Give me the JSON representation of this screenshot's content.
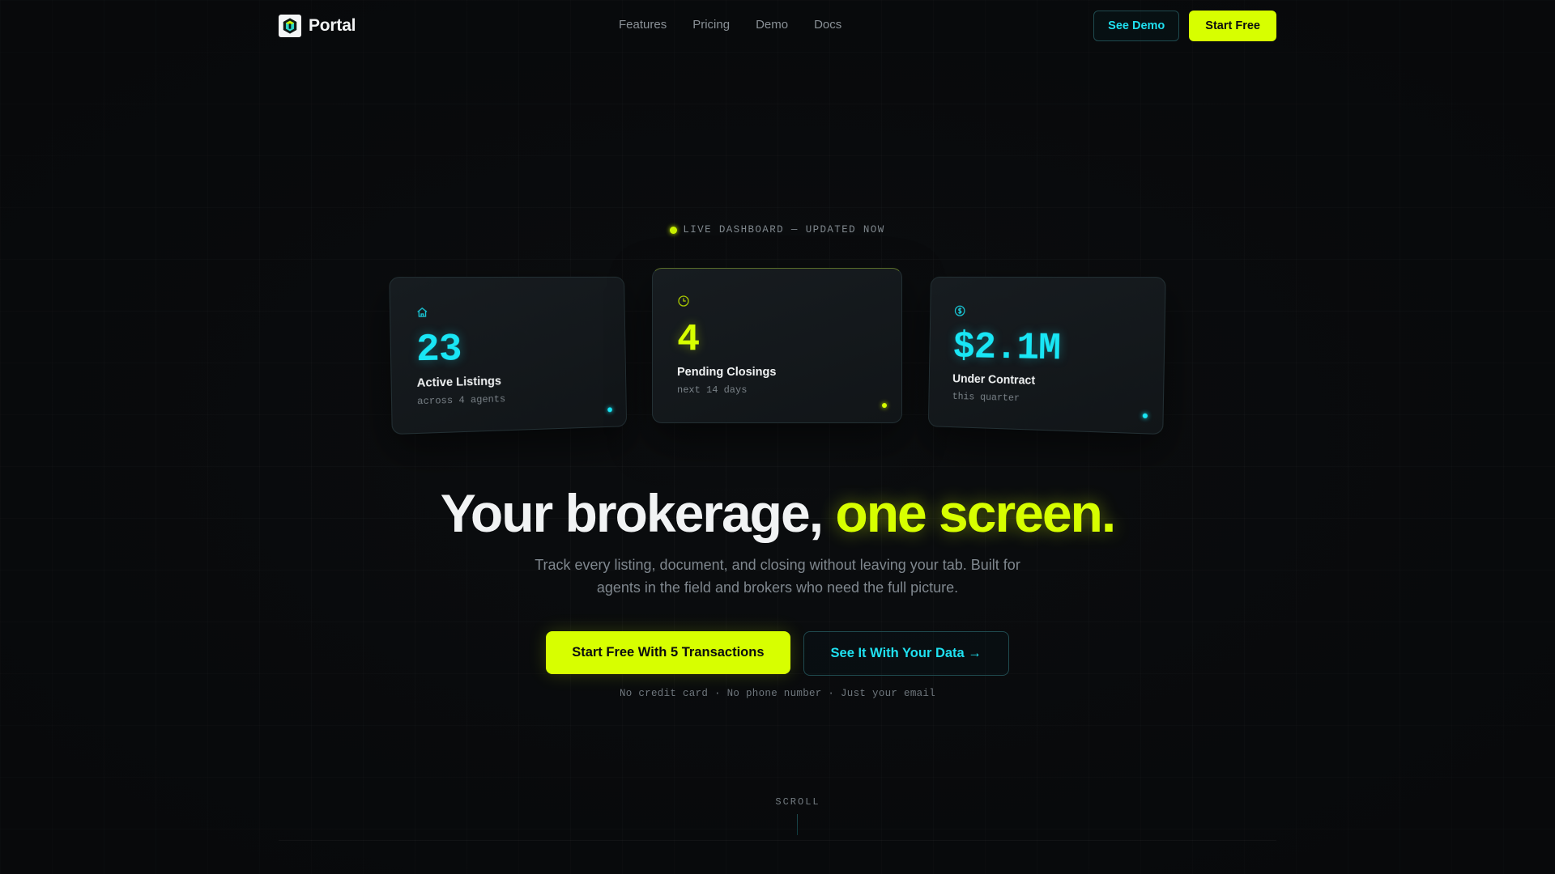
{
  "nav": {
    "brand": "Portal",
    "links": [
      "Features",
      "Pricing",
      "Demo",
      "Docs"
    ],
    "see_demo": "See Demo",
    "start_free": "Start Free"
  },
  "live": {
    "label": "LIVE DASHBOARD — UPDATED NOW"
  },
  "cards": [
    {
      "icon": "home-icon",
      "value": "23",
      "label": "Active Listings",
      "sub": "across 4 agents",
      "color": "#19e6f5"
    },
    {
      "icon": "clock-icon",
      "value": "4",
      "label": "Pending Closings",
      "sub": "next 14 days",
      "color": "#d7ff00"
    },
    {
      "icon": "dollar-icon",
      "value": "$2.1M",
      "label": "Under Contract",
      "sub": "this quarter",
      "color": "#19e6f5"
    }
  ],
  "hero": {
    "headline_main": "Your brokerage, ",
    "headline_accent": "one screen.",
    "subcopy": "Track every listing, document, and closing without leaving your tab. Built for agents in the field and brokers who need the full picture.",
    "cta_primary": "Start Free With 5 Transactions",
    "cta_secondary": "See It With Your Data →",
    "fineprint": "No credit card · No phone number · Just your email"
  },
  "scroll": {
    "label": "SCROLL"
  },
  "colors": {
    "accent_lime": "#d7ff00",
    "accent_cyan": "#19e6f5",
    "background": "#0b0d0f"
  }
}
